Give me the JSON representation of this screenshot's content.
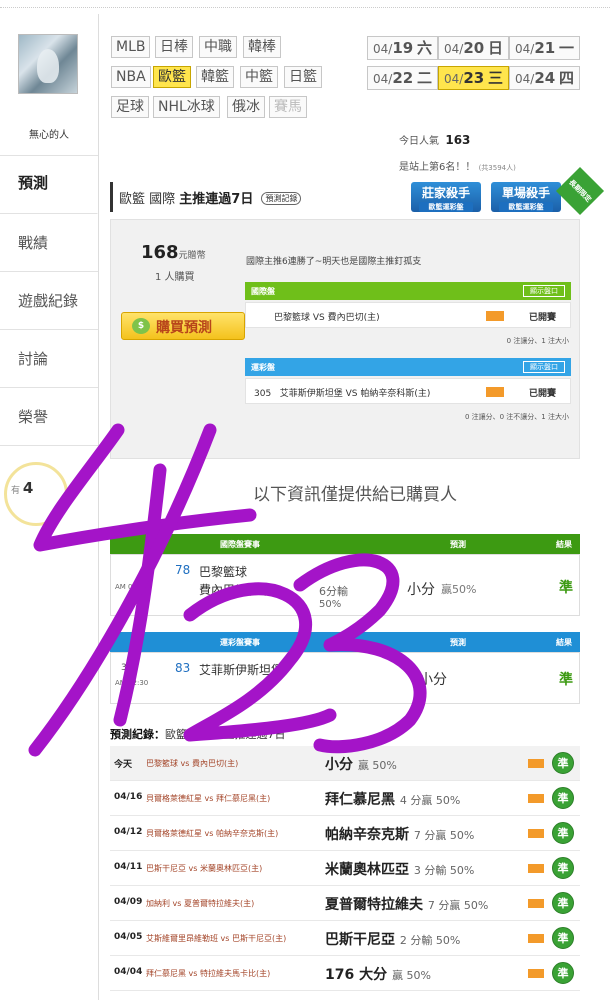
{
  "user": {
    "name": "無心的人"
  },
  "left_nav": [
    {
      "label": "預測",
      "active": true
    },
    {
      "label": "戰績",
      "active": false
    },
    {
      "label": "遊戲紀錄",
      "active": false
    },
    {
      "label": "討論",
      "active": false
    },
    {
      "label": "榮譽",
      "active": false
    }
  ],
  "rank": {
    "prefix": "有",
    "value": "4"
  },
  "sports": [
    {
      "label": "MLB"
    },
    {
      "label": "日棒"
    },
    {
      "label": "中職"
    },
    {
      "label": "韓棒"
    },
    {
      "label": "NBA"
    },
    {
      "label": "歐籃",
      "active": true
    },
    {
      "label": "韓籃"
    },
    {
      "label": "中籃"
    },
    {
      "label": "日籃"
    },
    {
      "label": "足球"
    },
    {
      "label": "NHL冰球"
    },
    {
      "label": "俄冰"
    },
    {
      "label": "賽馬",
      "disabled": true
    }
  ],
  "dates": [
    {
      "md": "04/",
      "d": "19",
      "w": "六"
    },
    {
      "md": "04/",
      "d": "20",
      "w": "日"
    },
    {
      "md": "04/",
      "d": "21",
      "w": "一"
    },
    {
      "md": "04/",
      "d": "22",
      "w": "二"
    },
    {
      "md": "04/",
      "d": "23",
      "w": "三",
      "active": true
    },
    {
      "md": "04/",
      "d": "24",
      "w": "四"
    }
  ],
  "popularity": {
    "label": "今日人氣",
    "value": "163",
    "rank_text": "是站上第6名！！",
    "rank_sub": "(共3594人)"
  },
  "banner": {
    "league": "歐籃 國際",
    "title": "主推連過7日",
    "record_tag": "預測記錄"
  },
  "killers": [
    {
      "title": "莊家殺手",
      "sub": "歐籃運彩盤"
    },
    {
      "title": "單場殺手",
      "sub": "歐籃運彩盤"
    }
  ],
  "ribbon": "長期限定",
  "offer": {
    "price": "168",
    "price_unit": "元贈幣",
    "buyers": "1 人購買",
    "buy_label": "購買預測",
    "streak_text": "國際主推6連勝了~明天也是國際主推釘孤支"
  },
  "intl": {
    "title": "國際盤",
    "show_line": "顯示盤口",
    "game": "巴黎籃球 VS 費內巴切(主)",
    "status": "已開賽",
    "notes": "0 注讓分、1 注大小"
  },
  "lottery": {
    "title": "運彩盤",
    "show_line": "顯示盤口",
    "num": "305",
    "game": "艾菲斯伊斯坦堡 VS 帕納辛奈科斯(主)",
    "status": "已開賽",
    "notes": "0 注讓分、0 注不讓分、1 注大小"
  },
  "purchasers_notice": "以下資訊僅提供給已購買人",
  "intl_table": {
    "headers": [
      "國際盤賽事",
      "預測",
      "結果"
    ],
    "time": "AM 02:45",
    "score": "78",
    "team": "巴黎籃球",
    "team2": "費內巴切(主)",
    "spread": "6分輸",
    "spread_pct": "50%",
    "pick": "小分",
    "pick_pct": "贏50%",
    "result": "準"
  },
  "lottery_table": {
    "headers": [
      "運彩盤賽事",
      "預測",
      "結果"
    ],
    "num": "305",
    "time": "AM 02:30",
    "score": "83",
    "team": "艾菲斯伊斯坦堡",
    "pick": "小分",
    "result": "準"
  },
  "records_label": {
    "prefix": "預測紀錄：",
    "text": "歐籃 國際盤主推連過7日"
  },
  "records": [
    {
      "date": "今天",
      "game": "巴黎籃球 vs 費內巴切(主)",
      "pick": "小分",
      "detail": "贏 50%",
      "result": "準"
    },
    {
      "date": "04/16",
      "game": "貝爾格萊德紅星 vs 拜仁慕尼黑(主)",
      "pick": "拜仁慕尼黑",
      "detail": "4 分贏 50%",
      "result": "準"
    },
    {
      "date": "04/12",
      "game": "貝爾格萊德紅星 vs 帕納辛奈克斯(主)",
      "pick": "帕納辛奈克斯",
      "detail": "7 分贏 50%",
      "result": "準"
    },
    {
      "date": "04/11",
      "game": "巴斯干尼亞 vs 米蘭奧林匹亞(主)",
      "pick": "米蘭奧林匹亞",
      "detail": "3 分輸 50%",
      "result": "準"
    },
    {
      "date": "04/09",
      "game": "加納利 vs 夏普爾特拉維夫(主)",
      "pick": "夏普爾特拉維夫",
      "detail": "7 分贏 50%",
      "result": "準"
    },
    {
      "date": "04/05",
      "game": "艾斯維爾里昂維勒班 vs 巴斯干尼亞(主)",
      "pick": "巴斯干尼亞",
      "detail": "2 分輸 50%",
      "result": "準"
    },
    {
      "date": "04/04",
      "game": "拜仁慕尼黑 vs 特拉維夫馬卡比(主)",
      "pick": "176 大分",
      "detail": "贏 50%",
      "result": "準"
    }
  ],
  "colors": {
    "accent_yellow": "#ffe54d",
    "green": "#3d9a12",
    "blue": "#1f8fd6",
    "handwriting": "#a414c8"
  },
  "annotation": {
    "text": "4/23",
    "type": "handwritten",
    "color": "#a414c8"
  }
}
